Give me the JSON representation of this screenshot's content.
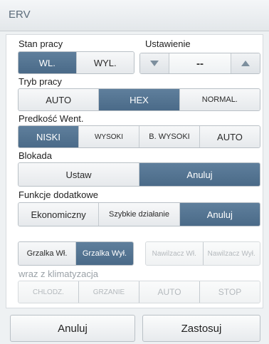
{
  "window": {
    "title": "ERV"
  },
  "stan_pracy": {
    "label": "Stan pracy",
    "options": [
      "WL.",
      "WYL."
    ]
  },
  "ustawienie": {
    "label": "Ustawienie",
    "value": "--",
    "down_icon": "triangle-down-icon",
    "up_icon": "triangle-up-icon"
  },
  "tryb_pracy": {
    "label": "Tryb pracy",
    "options": [
      "AUTO",
      "HEX",
      "NORMAL."
    ]
  },
  "predkosc": {
    "label": "Predkość Went.",
    "options": [
      "NISKI",
      "WYSOKI",
      "B. WYSOKI",
      "AUTO"
    ]
  },
  "blokada": {
    "label": "Blokada",
    "options": [
      "Ustaw",
      "Anuluj"
    ]
  },
  "funkcje": {
    "label": "Funkcje dodatkowe",
    "options": [
      "Ekonomiczny",
      "Szybkie działanie",
      "Anuluj"
    ]
  },
  "grzalka": {
    "options": [
      "Grzalka Wł.",
      "Grzalka Wył."
    ]
  },
  "nawilzacz": {
    "options": [
      "Nawilzacz Wł.",
      "Nawilzacz Wył."
    ]
  },
  "klimatyzacja": {
    "label": "wraz z klimatyzacja",
    "options": [
      "CHLODZ.",
      "GRZANIE",
      "AUTO",
      "STOP"
    ]
  },
  "footer": {
    "cancel": "Anuluj",
    "apply": "Zastosuj"
  }
}
